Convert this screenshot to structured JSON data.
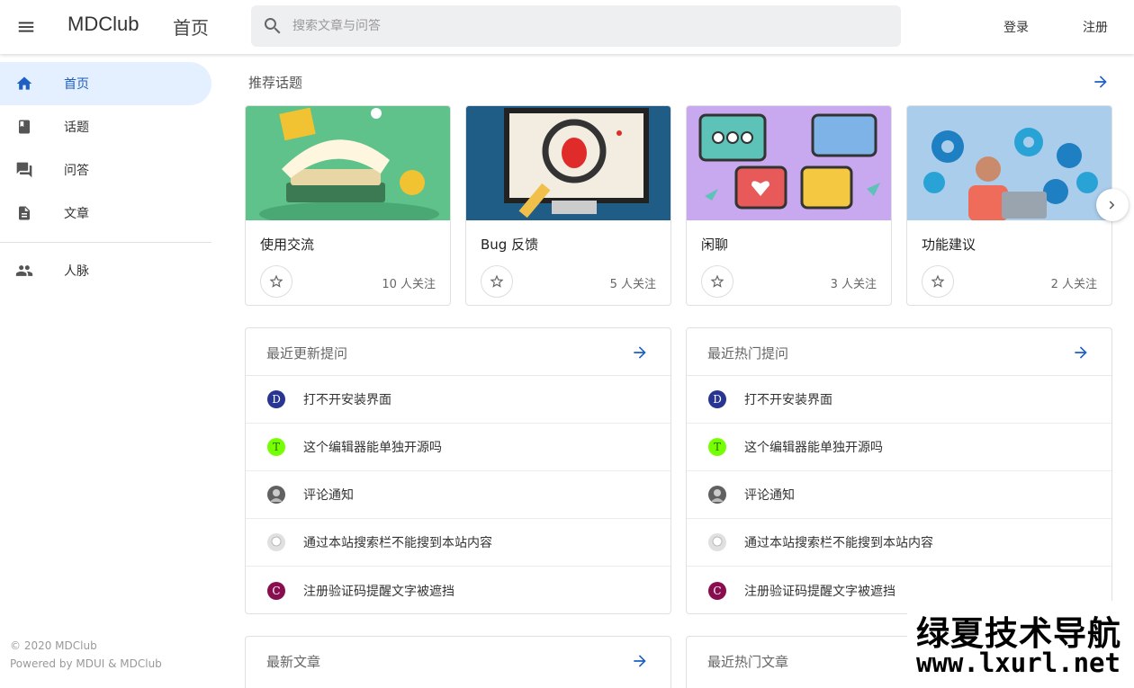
{
  "header": {
    "app_name": "MDClub",
    "page_name": "首页",
    "search_placeholder": "搜索文章与问答",
    "login_label": "登录",
    "register_label": "注册"
  },
  "sidebar": {
    "items": [
      {
        "label": "首页",
        "icon": "home-icon",
        "active": true
      },
      {
        "label": "话题",
        "icon": "book-icon"
      },
      {
        "label": "问答",
        "icon": "forum-icon"
      },
      {
        "label": "文章",
        "icon": "article-icon"
      },
      {
        "label": "人脉",
        "icon": "people-icon"
      }
    ],
    "footer": {
      "copyright": "© 2020 MDClub",
      "powered": "Powered by MDUI & MDClub"
    }
  },
  "topics": {
    "title": "推荐话题",
    "items": [
      {
        "name": "使用交流",
        "followers": "10 人关注",
        "image_color": "#5fc28a"
      },
      {
        "name": "Bug 反馈",
        "followers": "5 人关注",
        "image_color": "#1f5c86"
      },
      {
        "name": "闲聊",
        "followers": "3 人关注",
        "image_color": "#c8a8ee"
      },
      {
        "name": "功能建议",
        "followers": "2 人关注",
        "image_color": "#a9cdea"
      }
    ]
  },
  "recent_questions": {
    "title": "最近更新提问",
    "items": [
      {
        "title": "打不开安装界面",
        "avatar": "D",
        "avatar_color": "#283593"
      },
      {
        "title": "这个编辑器能单独开源吗",
        "avatar": "T",
        "avatar_color": "#76ff03"
      },
      {
        "title": "评论通知",
        "avatar": "",
        "avatar_color": "#616161"
      },
      {
        "title": "通过本站搜索栏不能搜到本站内容",
        "avatar": "",
        "avatar_color": "#e0e0e0"
      },
      {
        "title": "注册验证码提醒文字被遮挡",
        "avatar": "C",
        "avatar_color": "#880e4f"
      }
    ]
  },
  "hot_questions": {
    "title": "最近热门提问",
    "items": [
      {
        "title": "打不开安装界面",
        "avatar": "D",
        "avatar_color": "#283593"
      },
      {
        "title": "这个编辑器能单独开源吗",
        "avatar": "T",
        "avatar_color": "#76ff03"
      },
      {
        "title": "评论通知",
        "avatar": "",
        "avatar_color": "#616161"
      },
      {
        "title": "通过本站搜索栏不能搜到本站内容",
        "avatar": "",
        "avatar_color": "#e0e0e0"
      },
      {
        "title": "注册验证码提醒文字被遮挡",
        "avatar": "C",
        "avatar_color": "#880e4f"
      }
    ]
  },
  "latest_articles": {
    "title": "最新文章"
  },
  "hot_articles": {
    "title": "最近热门文章"
  },
  "watermark": {
    "line1": "绿夏技术导航",
    "line2": "www.lxurl.net"
  },
  "colors": {
    "accent": "#1e5fc3",
    "active_bg": "#e4efff"
  }
}
